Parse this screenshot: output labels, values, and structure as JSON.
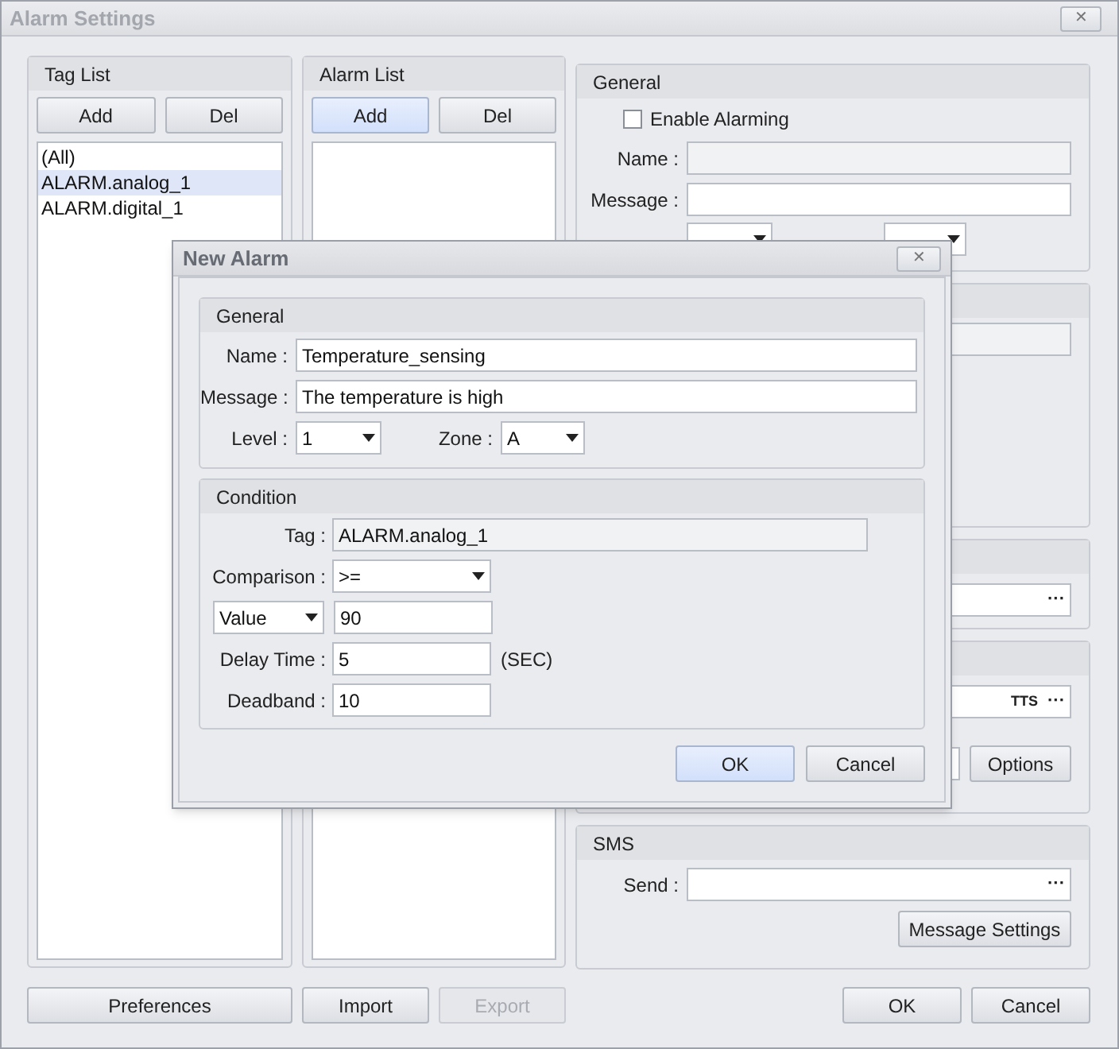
{
  "window": {
    "title": "Alarm Settings",
    "close": "✕"
  },
  "tag_list": {
    "title": "Tag List",
    "buttons": [
      {
        "label": "Add",
        "focused": false
      },
      {
        "label": "Del",
        "focused": false
      }
    ],
    "items": [
      {
        "label": "(All)",
        "selected": false
      },
      {
        "label": "ALARM.analog_1",
        "selected": true
      },
      {
        "label": "ALARM.digital_1",
        "selected": false
      }
    ]
  },
  "alarm_list": {
    "title": "Alarm List",
    "buttons": [
      {
        "label": "Add",
        "focused": true
      },
      {
        "label": "Del",
        "focused": false
      }
    ]
  },
  "general": {
    "title": "General",
    "enable_alarming": {
      "label": "Enable Alarming",
      "checked": false
    },
    "name": {
      "label": "Name :",
      "disabled": true
    },
    "message": {
      "label": "Message :",
      "disabled": false
    }
  },
  "group_3": {
    "browse": "···"
  },
  "group_4": {
    "tts": "TTS",
    "browse": "···",
    "options": "Options"
  },
  "sms": {
    "title": "SMS",
    "send_label": "Send :",
    "browse": "···",
    "message_settings": "Message Settings"
  },
  "bottom_buttons": [
    {
      "label": "Preferences",
      "disabled": false
    },
    {
      "label": "Import",
      "disabled": false
    },
    {
      "label": "Export",
      "disabled": true
    }
  ],
  "dialog_buttons": [
    {
      "label": "OK"
    },
    {
      "label": "Cancel"
    }
  ],
  "new_alarm": {
    "title": "New Alarm",
    "close": "✕",
    "general": {
      "title": "General",
      "name": {
        "label": "Name :",
        "value": "Temperature_sensing"
      },
      "message": {
        "label": "Message :",
        "value": "The temperature is high"
      },
      "level": {
        "label": "Level :",
        "value": "1"
      },
      "zone": {
        "label": "Zone :",
        "value": "A"
      }
    },
    "condition": {
      "title": "Condition",
      "tag": {
        "label": "Tag :",
        "value": "ALARM.analog_1"
      },
      "comparison": {
        "label": "Comparison :",
        "value": ">="
      },
      "value_type": "Value",
      "value": "90",
      "delay": {
        "label": "Delay Time :",
        "value": "5",
        "unit": "(SEC)"
      },
      "deadband": {
        "label": "Deadband :",
        "value": "10"
      }
    },
    "buttons": [
      {
        "label": "OK",
        "focused": true
      },
      {
        "label": "Cancel",
        "focused": false
      }
    ]
  }
}
